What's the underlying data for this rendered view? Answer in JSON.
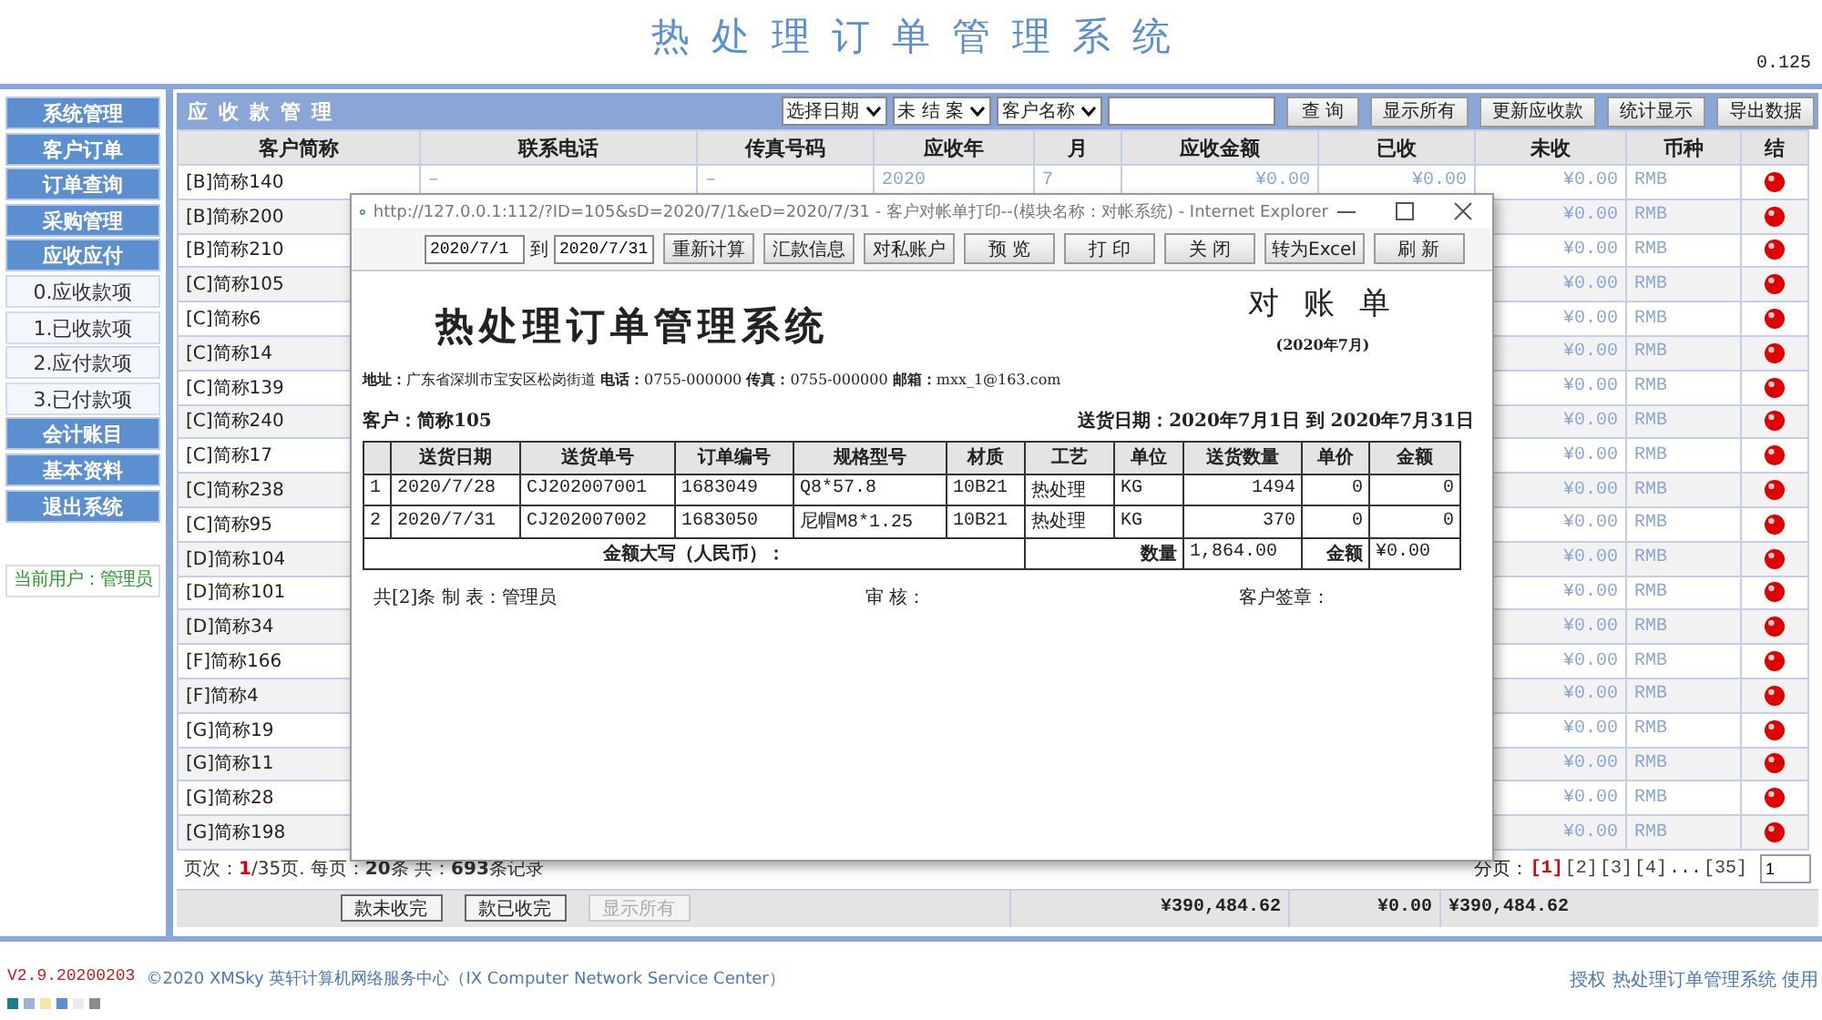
{
  "app_title": "热处理订单管理系统",
  "version_badge": "0.125",
  "sidebar": {
    "items": [
      {
        "label": "系统管理",
        "kind": "main"
      },
      {
        "label": "客户订单",
        "kind": "main"
      },
      {
        "label": "订单查询",
        "kind": "main"
      },
      {
        "label": "采购管理",
        "kind": "main"
      },
      {
        "label": "应收应付",
        "kind": "main"
      },
      {
        "label": "0.应收款项",
        "kind": "sub"
      },
      {
        "label": "1.已收款项",
        "kind": "sub"
      },
      {
        "label": "2.应付款项",
        "kind": "sub"
      },
      {
        "label": "3.已付款项",
        "kind": "sub"
      },
      {
        "label": "会计账目",
        "kind": "main"
      },
      {
        "label": "基本资料",
        "kind": "main"
      },
      {
        "label": "退出系统",
        "kind": "main"
      }
    ],
    "current_user": "当前用户：管理员"
  },
  "panel": {
    "title": "应收款管理",
    "filters": [
      {
        "kind": "select",
        "value": "选择日期"
      },
      {
        "kind": "select",
        "value": "未 结 案"
      },
      {
        "kind": "select",
        "value": "客户名称"
      },
      {
        "kind": "input"
      }
    ],
    "buttons": [
      "查 询",
      "显示所有",
      "更新应收款",
      "统计显示",
      "导出数据"
    ]
  },
  "table": {
    "columns": [
      "客户简称",
      "联系电话",
      "传真号码",
      "应收年",
      "月",
      "应收金额",
      "已收",
      "未收",
      "币种",
      "结"
    ],
    "rows": [
      {
        "customer": "[B]简称140",
        "phone": "–",
        "fax": "–",
        "year": "2020",
        "month": "7",
        "receivable": "¥0.00",
        "received": "¥0.00",
        "unpaid": "¥0.00",
        "currency": "RMB",
        "settled": false
      },
      {
        "customer": "[B]简称200",
        "unpaid": "¥0.00",
        "currency": "RMB",
        "settled": false
      },
      {
        "customer": "[B]简称210",
        "unpaid": "¥0.00",
        "currency": "RMB",
        "settled": false
      },
      {
        "customer": "[C]简称105",
        "unpaid": "¥0.00",
        "currency": "RMB",
        "settled": false
      },
      {
        "customer": "[C]简称6",
        "unpaid": "¥0.00",
        "currency": "RMB",
        "settled": false
      },
      {
        "customer": "[C]简称14",
        "unpaid": "¥0.00",
        "currency": "RMB",
        "settled": false
      },
      {
        "customer": "[C]简称139",
        "unpaid": "¥0.00",
        "currency": "RMB",
        "settled": false
      },
      {
        "customer": "[C]简称240",
        "unpaid": "¥0.00",
        "currency": "RMB",
        "settled": false
      },
      {
        "customer": "[C]简称17",
        "unpaid": "¥0.00",
        "currency": "RMB",
        "settled": false
      },
      {
        "customer": "[C]简称238",
        "unpaid": "¥0.00",
        "currency": "RMB",
        "settled": false
      },
      {
        "customer": "[C]简称95",
        "unpaid": "¥0.00",
        "currency": "RMB",
        "settled": false
      },
      {
        "customer": "[D]简称104",
        "unpaid": "¥0.00",
        "currency": "RMB",
        "settled": false
      },
      {
        "customer": "[D]简称101",
        "unpaid": "¥0.00",
        "currency": "RMB",
        "settled": false
      },
      {
        "customer": "[D]简称34",
        "unpaid": "¥0.00",
        "currency": "RMB",
        "settled": false
      },
      {
        "customer": "[F]简称166",
        "unpaid": "¥0.00",
        "currency": "RMB",
        "settled": false
      },
      {
        "customer": "[F]简称4",
        "unpaid": "¥0.00",
        "currency": "RMB",
        "settled": false
      },
      {
        "customer": "[G]简称19",
        "unpaid": "¥0.00",
        "currency": "RMB",
        "settled": false
      },
      {
        "customer": "[G]简称11",
        "unpaid": "¥0.00",
        "currency": "RMB",
        "settled": false
      },
      {
        "customer": "[G]简称28",
        "unpaid": "¥0.00",
        "currency": "RMB",
        "settled": false
      },
      {
        "customer": "[G]简称198",
        "unpaid": "¥0.00",
        "currency": "RMB",
        "settled": false
      }
    ]
  },
  "pagination": {
    "info": "页次：**1**/35页. 每页：**20**条 共：**693**条记录",
    "label": "分页：",
    "pages": [
      {
        "kind": "page",
        "label": "[1]",
        "selected": true
      },
      {
        "kind": "page",
        "label": "[2]",
        "selected": false
      },
      {
        "kind": "page",
        "label": "[3]",
        "selected": false
      },
      {
        "kind": "page",
        "label": "[4]",
        "selected": false
      },
      {
        "kind": "gap",
        "label": "..."
      },
      {
        "kind": "page",
        "label": "[35]",
        "selected": false
      }
    ],
    "page_input": "1"
  },
  "footer": {
    "buttons": [
      {
        "label": "款未收完",
        "disabled": false
      },
      {
        "label": "款已收完",
        "disabled": false
      },
      {
        "label": "显示所有",
        "disabled": true
      }
    ],
    "totals": {
      "receivable": "¥390,484.62",
      "received": "¥0.00",
      "unpaid": "¥390,484.62"
    }
  },
  "popup": {
    "title": "http://127.0.0.1:112/?ID=105&sD=2020/7/1&eD=2020/7/31 - 客户对帐单打印--(模块名称：对帐系统) - Internet Explorer",
    "date_from": "2020/7/1",
    "to_label": "到",
    "date_to": "2020/7/31",
    "buttons": [
      "重新计算",
      "汇款信息",
      "对私账户",
      "预 览",
      "打 印",
      "关 闭",
      "转为Excel",
      "刷 新"
    ],
    "company": "热处理订单管理系统",
    "doc_title": "对 账 单",
    "period": "(2020年7月)",
    "address": "**地址：**广东省深圳市宝安区松岗街道 **电话：**0755-000000 **传真：**0755-000000 **邮箱：**mxx_1@163.com",
    "customer": "客户：简称105",
    "delivery_range": "送货日期：2020年7月1日 到 2020年7月31日",
    "columns": [
      "",
      "送货日期",
      "送货单号",
      "订单编号",
      "规格型号",
      "材质",
      "工艺",
      "单位",
      "送货数量",
      "单价",
      "金额"
    ],
    "rows": [
      [
        "1",
        "2020/7/28",
        "CJ202007001",
        "1683049",
        "Q8*57.8",
        "10B21",
        "热处理",
        "KG",
        "1494",
        "0",
        "0"
      ],
      [
        "2",
        "2020/7/31",
        "CJ202007002",
        "1683050",
        "尼帽M8*1.25",
        "10B21",
        "热处理",
        "KG",
        "370",
        "0",
        "0"
      ]
    ],
    "total_words_label": "金额大写（人民币）：",
    "quantity_label": "数量",
    "quantity_total": "1,864.00",
    "amount_label": "金额",
    "amount_total": "¥0.00",
    "sign_line": [
      "共[2]条 制 表：管理员",
      "审 核：",
      "客户签章："
    ]
  },
  "status_bar": {
    "version": "V2.9.20200203",
    "copyright": "©2020 XMSky 英轩计算机网络服务中心（IX Computer Network Service Center）",
    "license": "授权 热处理订单管理系统 使用"
  },
  "theme_swatches": [
    {
      "color": "#17808c"
    },
    {
      "color": "#9db3dc"
    },
    {
      "color": "#f3e7a6"
    },
    {
      "color": "#5b8fd0"
    },
    {
      "color": "#ececec"
    },
    {
      "color": "#8c8c8c"
    }
  ]
}
